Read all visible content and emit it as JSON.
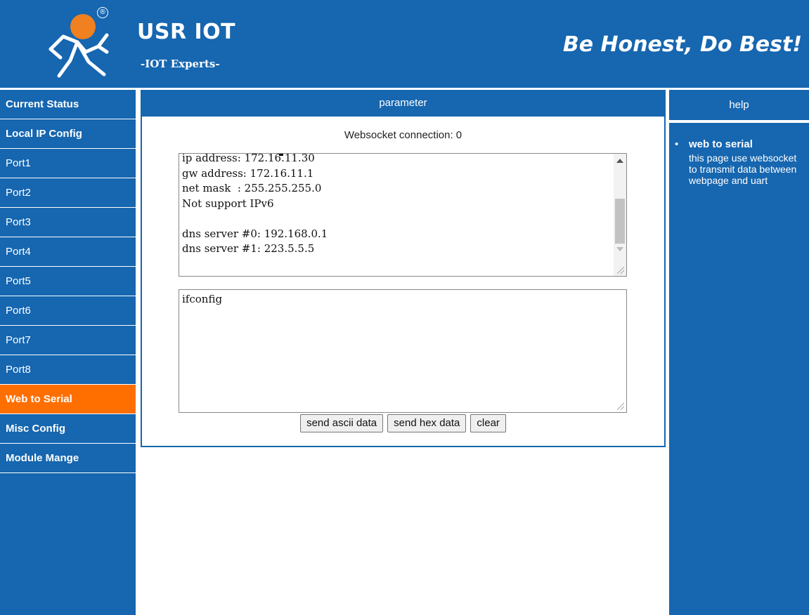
{
  "header": {
    "brand": "USR IOT",
    "subbrand": "-IOT Experts-",
    "slogan": "Be Honest, Do Best!",
    "registered_mark": "®"
  },
  "nav": {
    "items": [
      {
        "label": "Current Status",
        "active": false
      },
      {
        "label": "Local IP Config",
        "active": false
      },
      {
        "label": "Port1",
        "active": false
      },
      {
        "label": "Port2",
        "active": false
      },
      {
        "label": "Port3",
        "active": false
      },
      {
        "label": "Port4",
        "active": false
      },
      {
        "label": "Port5",
        "active": false
      },
      {
        "label": "Port6",
        "active": false
      },
      {
        "label": "Port7",
        "active": false
      },
      {
        "label": "Port8",
        "active": false
      },
      {
        "label": "Web to Serial",
        "active": true
      },
      {
        "label": "Misc Config",
        "active": false
      },
      {
        "label": "Module Mange",
        "active": false
      }
    ]
  },
  "main": {
    "header": "parameter",
    "ws_status": "Websocket connection: 0",
    "output_text": "ip address: 172.16.11.30\ngw address: 172.16.11.1\nnet mask  : 255.255.255.0\nNot support IPv6\n\ndns server #0: 192.168.0.1\ndns server #1: 223.5.5.5",
    "input_value": "ifconfig",
    "buttons": {
      "send_ascii": "send ascii data",
      "send_hex": "send hex data",
      "clear": "clear"
    }
  },
  "help": {
    "header": "help",
    "bullet": "•",
    "title": "web to serial",
    "description": "this page use websocket to transmit data between webpage and uart"
  },
  "colors": {
    "primary_blue": "#1666b0",
    "active_orange": "#ff6f00",
    "logo_orange": "#f08020"
  }
}
